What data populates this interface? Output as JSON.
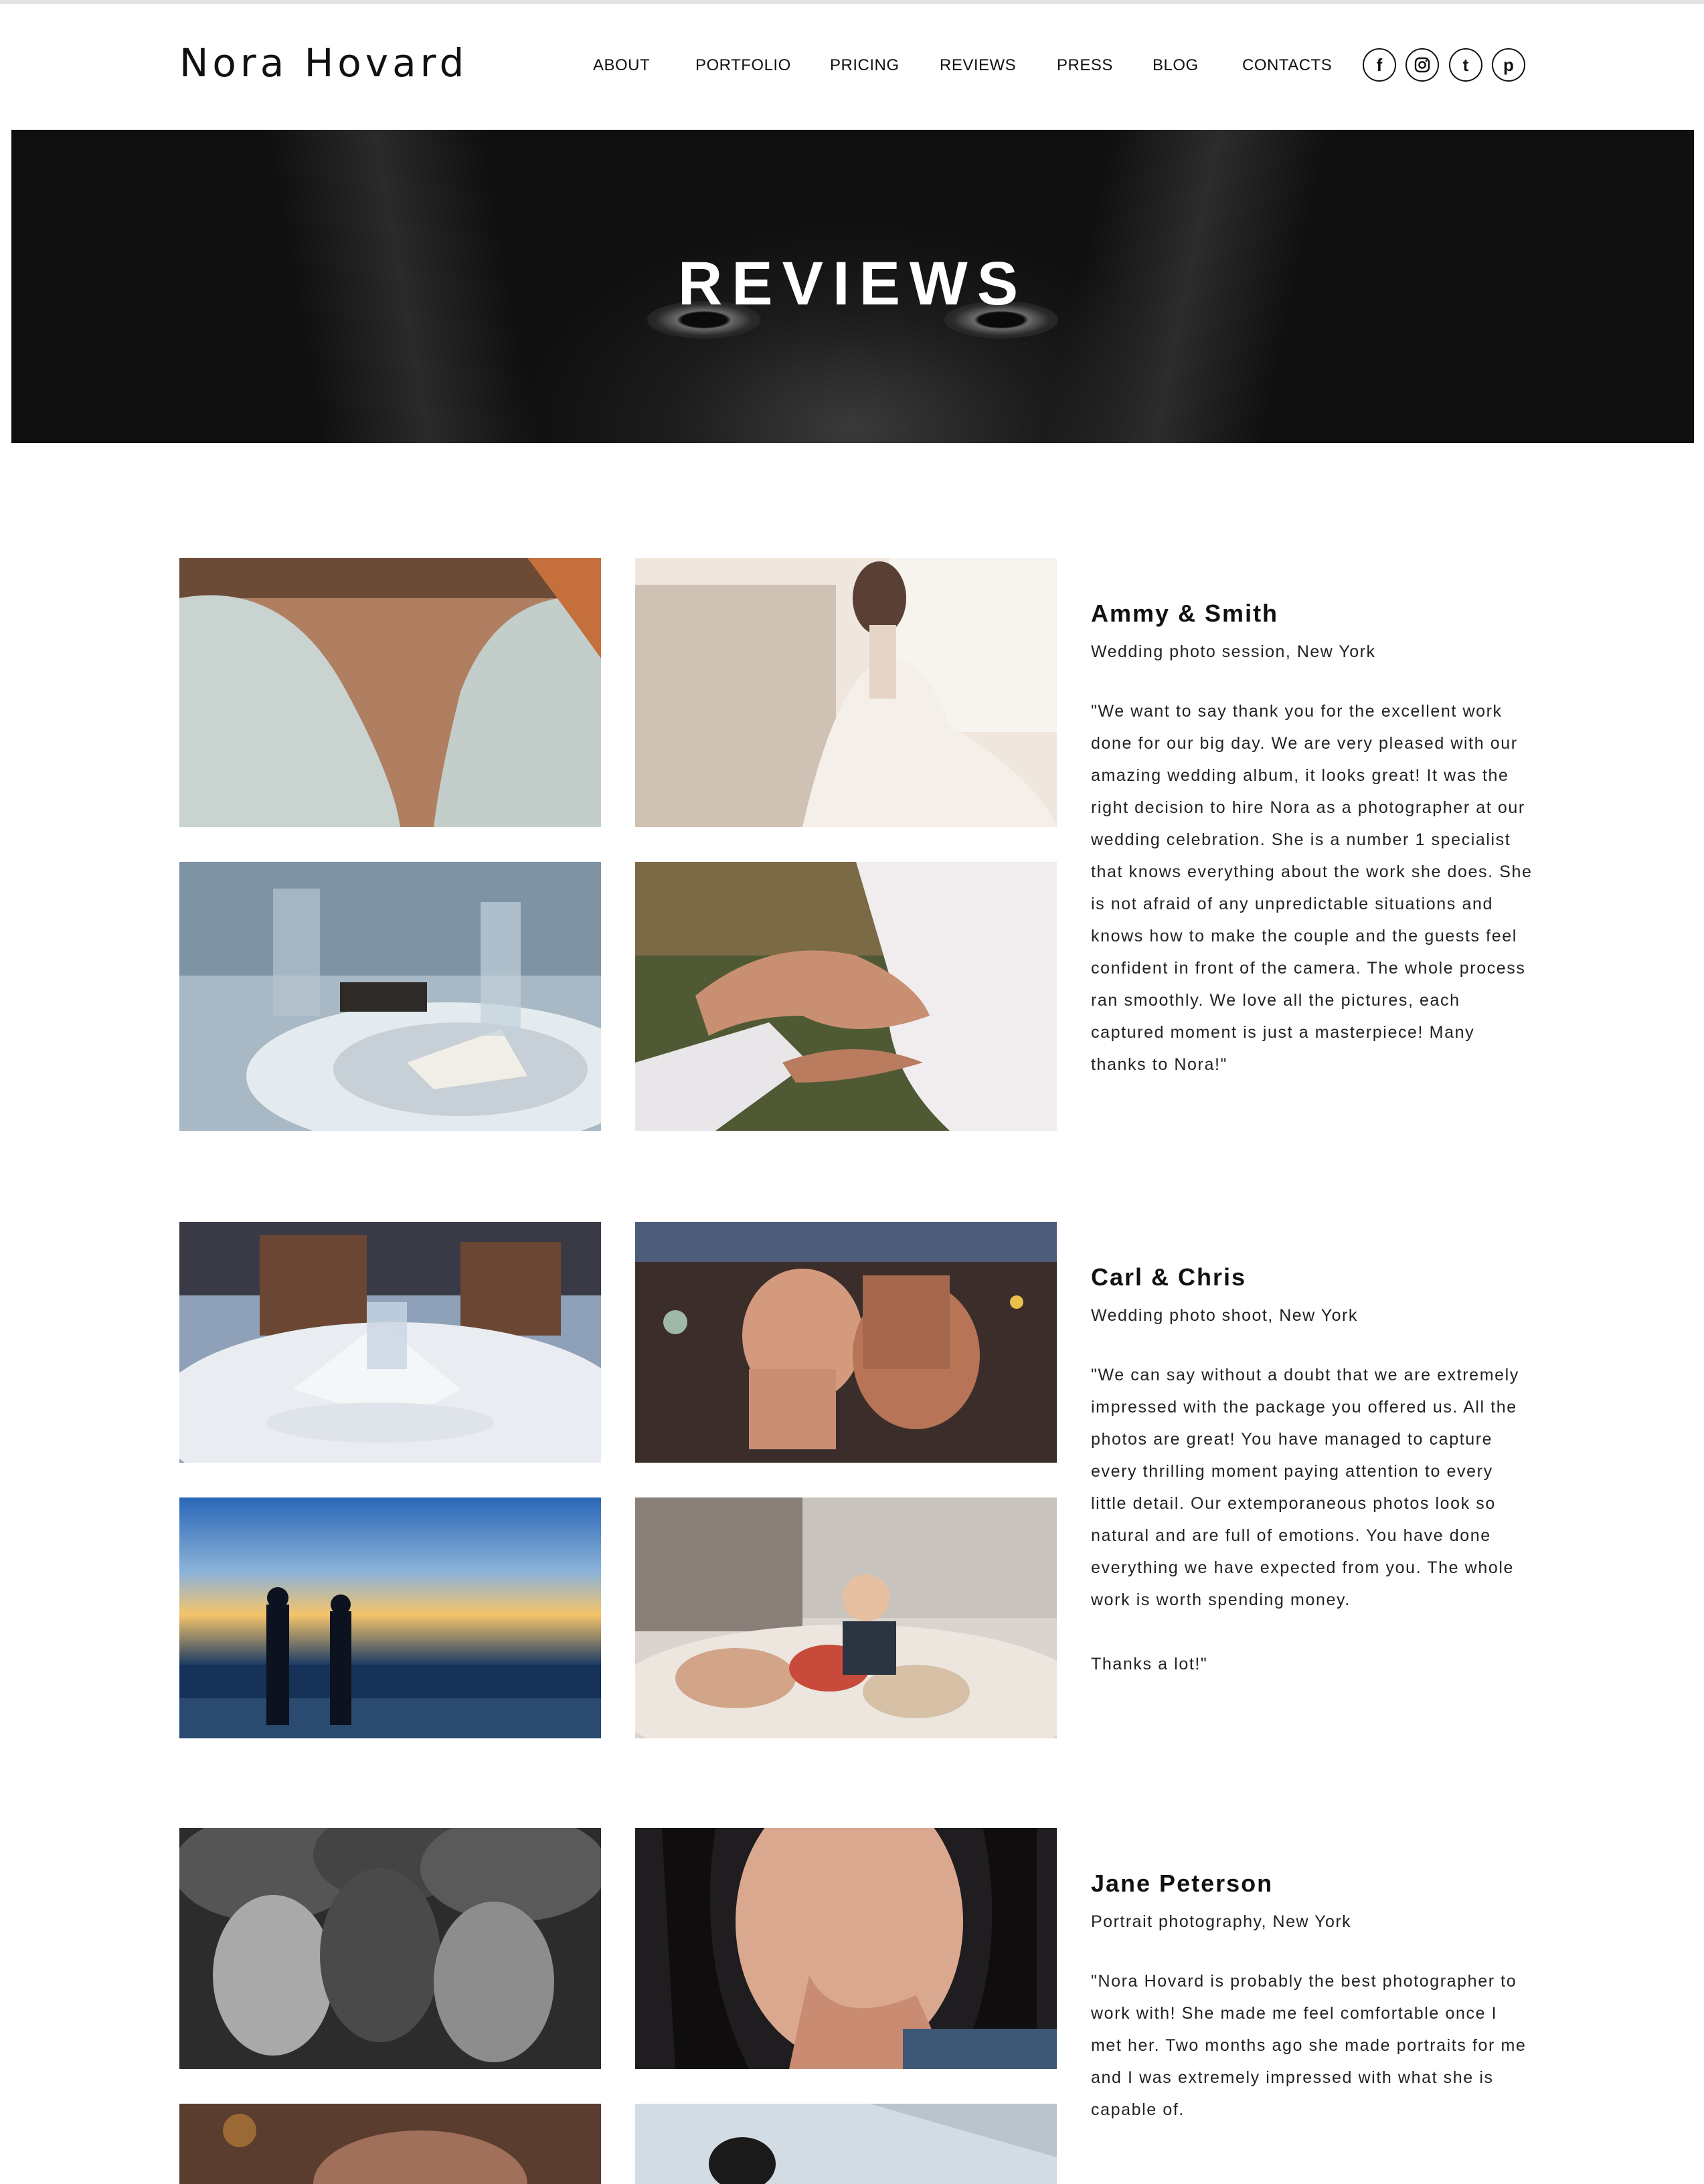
{
  "site": {
    "logo": "Nora Hovard",
    "nav": [
      "ABOUT",
      "PORTFOLIO",
      "PRICING",
      "REVIEWS",
      "PRESS",
      "BLOG",
      "CONTACTS"
    ],
    "social": [
      {
        "icon": "facebook-icon",
        "glyph": "f"
      },
      {
        "icon": "instagram-icon",
        "glyph": ""
      },
      {
        "icon": "tumblr-icon",
        "glyph": "t"
      },
      {
        "icon": "pinterest-icon",
        "glyph": "p"
      }
    ]
  },
  "hero": {
    "title": "REVIEWS"
  },
  "reviews": [
    {
      "name": "Ammy & Smith",
      "subtitle": "Wedding photo session, New York",
      "paragraphs": [
        "\"We want to say thank you for the excellent work done for our big day. We are very pleased with our amazing wedding album, it looks great! It was the right decision to hire Nora as a photographer at our wedding celebration. She is a number 1 specialist that knows everything about the work she does. She is not afraid of any unpredictable situations and knows how to make the couple and the guests feel confident in front of the camera. The whole process ran smoothly. We love all the pictures, each captured moment is just a masterpiece! Many thanks to Nora!\""
      ],
      "photos": [
        "lace-dress-back",
        "bride-on-sofa",
        "groom-table-setting",
        "holding-hands"
      ]
    },
    {
      "name": "Carl & Chris",
      "subtitle": "Wedding photo shoot, New York",
      "paragraphs": [
        "\"We can say without a doubt that we are extremely impressed with the package you offered us. All the photos are great! You have managed to capture every thrilling moment paying attention to every little detail. Our extemporaneous photos look so natural and are full of emotions. You have done everything we have expected from you. The whole work is worth spending money.",
        "Thanks a lot!\""
      ],
      "photos": [
        "restaurant-table",
        "two-women-flowers",
        "couple-sunset-beach",
        "child-with-camera"
      ]
    },
    {
      "name": "Jane Peterson",
      "subtitle": "Portrait photography, New York",
      "paragraphs": [
        "\"Nora Hovard is probably the best photographer to work with! She made me feel comfortable once I met her. Two months ago she made portraits for me and I was extremely impressed with what she is capable of."
      ],
      "photos": [
        "three-women-portrait",
        "woman-portrait",
        "portrait-3",
        "portrait-4"
      ]
    }
  ]
}
